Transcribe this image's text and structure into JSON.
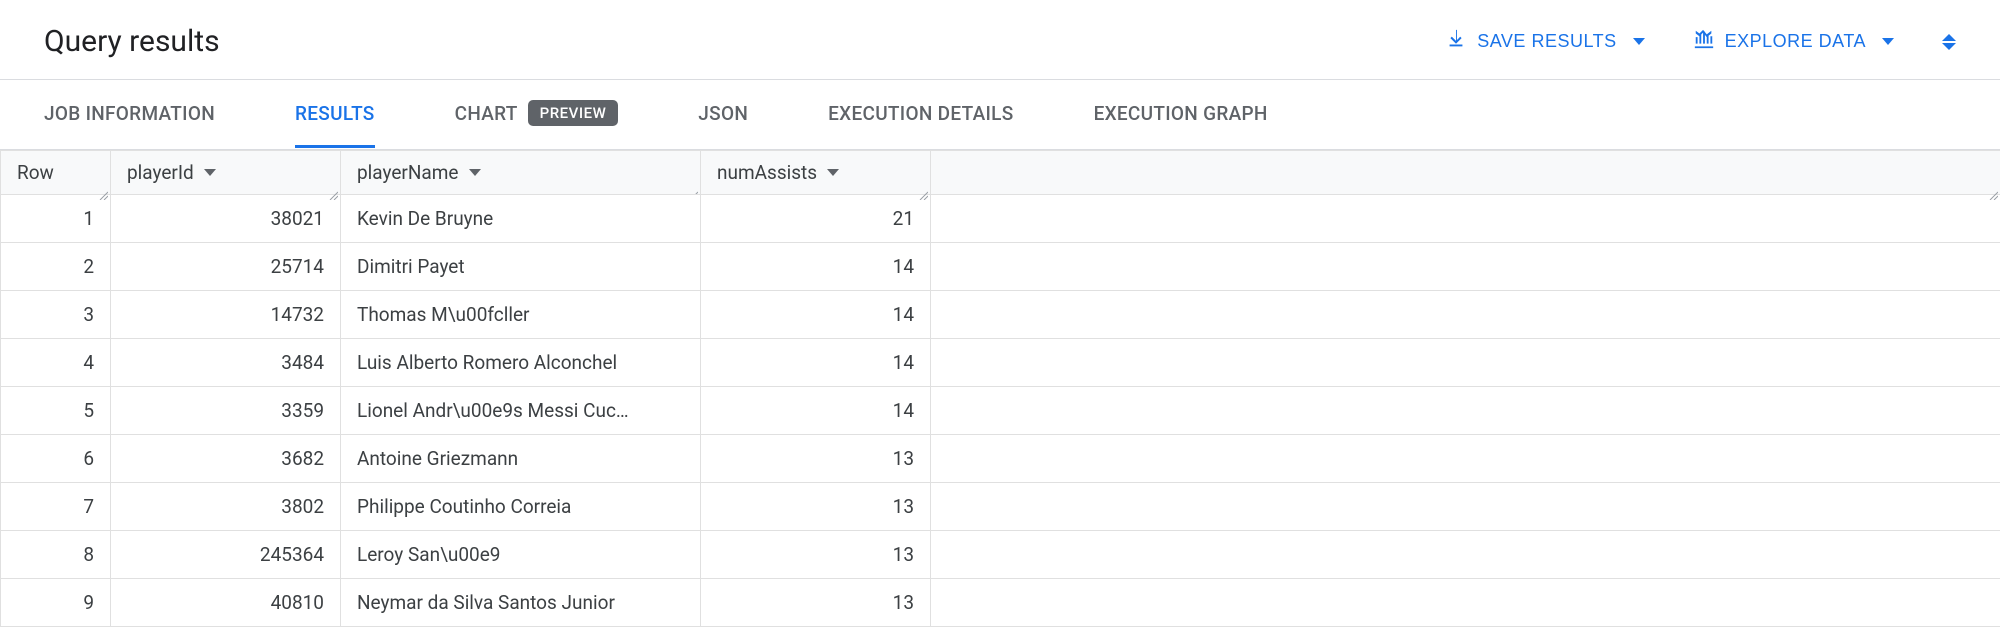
{
  "header": {
    "title": "Query results",
    "save_results_label": "SAVE RESULTS",
    "explore_data_label": "EXPLORE DATA"
  },
  "tabs": {
    "items": [
      {
        "id": "job-information",
        "label": "JOB INFORMATION",
        "active": false
      },
      {
        "id": "results",
        "label": "RESULTS",
        "active": true
      },
      {
        "id": "chart",
        "label": "CHART",
        "active": false,
        "badge": "PREVIEW"
      },
      {
        "id": "json",
        "label": "JSON",
        "active": false
      },
      {
        "id": "execution-details",
        "label": "EXECUTION DETAILS",
        "active": false
      },
      {
        "id": "execution-graph",
        "label": "EXECUTION GRAPH",
        "active": false
      }
    ]
  },
  "table": {
    "columns": [
      {
        "key": "row",
        "label": "Row",
        "sortable": false
      },
      {
        "key": "playerId",
        "label": "playerId",
        "sortable": true
      },
      {
        "key": "playerName",
        "label": "playerName",
        "sortable": true
      },
      {
        "key": "numAssists",
        "label": "numAssists",
        "sortable": true
      }
    ],
    "rows": [
      {
        "row": "1",
        "playerId": "38021",
        "playerName": "Kevin De Bruyne",
        "numAssists": "21"
      },
      {
        "row": "2",
        "playerId": "25714",
        "playerName": "Dimitri  Payet",
        "numAssists": "14"
      },
      {
        "row": "3",
        "playerId": "14732",
        "playerName": "Thomas M\\u00fcller",
        "numAssists": "14"
      },
      {
        "row": "4",
        "playerId": "3484",
        "playerName": "Luis Alberto Romero Alconchel",
        "numAssists": "14"
      },
      {
        "row": "5",
        "playerId": "3359",
        "playerName": "Lionel Andr\\u00e9s Messi Cuc…",
        "numAssists": "14"
      },
      {
        "row": "6",
        "playerId": "3682",
        "playerName": "Antoine Griezmann",
        "numAssists": "13"
      },
      {
        "row": "7",
        "playerId": "3802",
        "playerName": "Philippe Coutinho Correia",
        "numAssists": "13"
      },
      {
        "row": "8",
        "playerId": "245364",
        "playerName": "Leroy San\\u00e9",
        "numAssists": "13"
      },
      {
        "row": "9",
        "playerId": "40810",
        "playerName": "Neymar da Silva Santos Junior",
        "numAssists": "13"
      }
    ]
  }
}
